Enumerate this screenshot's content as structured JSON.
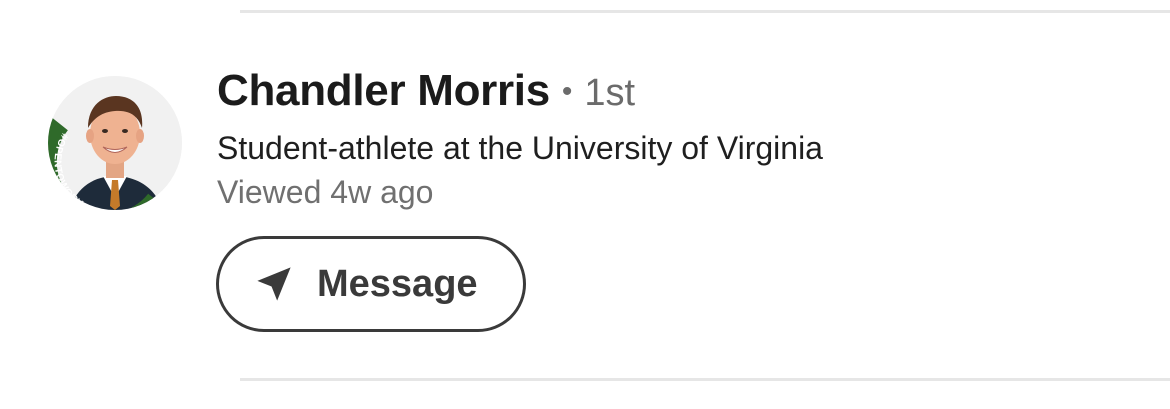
{
  "profile": {
    "name": "Chandler Morris",
    "separator": "•",
    "degree": "1st",
    "headline": "Student-athlete at the University of Virginia",
    "viewed": "Viewed 4w ago",
    "avatar_badge": "#OPENTOWORK"
  },
  "actions": {
    "message_label": "Message",
    "message_icon": "send-icon"
  },
  "colors": {
    "open_to_work_green": "#2f6a2a",
    "text_primary": "#1b1b1b",
    "text_secondary": "#6b6b6b"
  }
}
